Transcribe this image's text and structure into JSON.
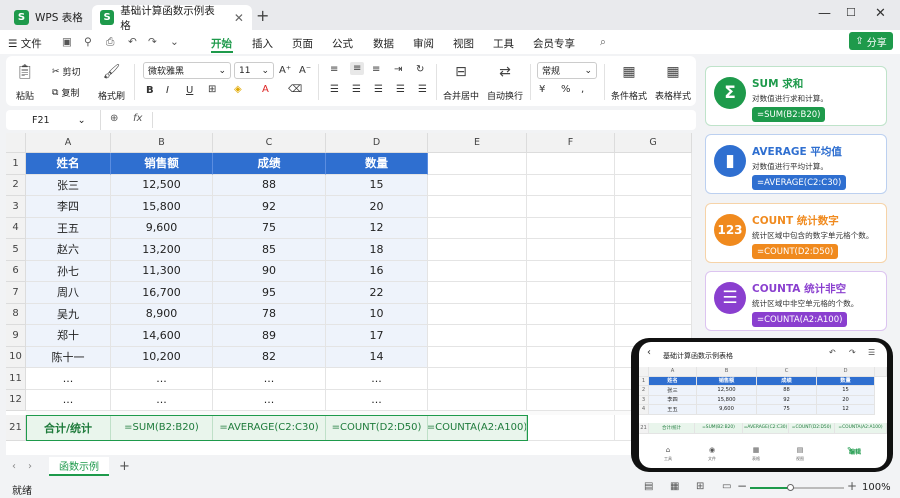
{
  "titlebar": {
    "tabs": [
      {
        "label": "WPS 表格"
      },
      {
        "label": "基础计算函数示例表格"
      }
    ],
    "new_tab": "+",
    "window_controls": [
      "—",
      "❐",
      "☐",
      "✕"
    ]
  },
  "menubar": {
    "file": "文件",
    "items": [
      {
        "label": "开始"
      },
      {
        "label": "插入"
      },
      {
        "label": "页面"
      },
      {
        "label": "公式"
      },
      {
        "label": "数据"
      },
      {
        "label": "审阅"
      },
      {
        "label": "视图"
      },
      {
        "label": "工具"
      },
      {
        "label": "会员专享"
      }
    ],
    "share": "分享"
  },
  "ribbon": {
    "paste": "粘贴",
    "cut": "剪切",
    "copy": "复制",
    "format_painter": "格式刷",
    "font_name": "微软雅黑",
    "font_size": "11",
    "merge": "合并居中",
    "wrap": "自动换行",
    "number_format": "常规",
    "conditional": "条件格式",
    "table_style": "表格样式"
  },
  "formula_bar": {
    "name_box": "F21",
    "fx": "fx",
    "value": ""
  },
  "columns": [
    "A",
    "B",
    "C",
    "D",
    "E",
    "F",
    "G"
  ],
  "rows": [
    "1",
    "2",
    "3",
    "4",
    "5",
    "6",
    "7",
    "8",
    "9",
    "10",
    "11",
    "12",
    "21"
  ],
  "table": {
    "headers": [
      "姓名",
      "销售额",
      "成绩",
      "数量"
    ],
    "data": [
      [
        "张三",
        "12,500",
        "88",
        "15"
      ],
      [
        "李四",
        "15,800",
        "92",
        "20"
      ],
      [
        "王五",
        "9,600",
        "75",
        "12"
      ],
      [
        "赵六",
        "13,200",
        "85",
        "18"
      ],
      [
        "孙七",
        "11,300",
        "90",
        "16"
      ],
      [
        "周八",
        "16,700",
        "95",
        "22"
      ],
      [
        "吴九",
        "8,900",
        "78",
        "10"
      ],
      [
        "郑十",
        "14,600",
        "89",
        "17"
      ],
      [
        "陈十一",
        "10,200",
        "82",
        "14"
      ],
      [
        "...",
        "...",
        "...",
        "..."
      ],
      [
        "...",
        "...",
        "...",
        "..."
      ]
    ],
    "totals": [
      "合计/统计",
      "=SUM(B2:B20)",
      "=AVERAGE(C2:C30)",
      "=COUNT(D2:D50)",
      "=COUNTA(A2:A100)"
    ]
  },
  "sheet_tabs": [
    {
      "label": "函数示例"
    }
  ],
  "status": {
    "left": "就绪",
    "zoom": "100%"
  },
  "cards": [
    {
      "icon": "Σ",
      "title": "SUM 求和",
      "desc": "对数值进行求和计算。",
      "formula": "=SUM(B2:B20)",
      "color": "#1e9a4b",
      "bg": "#ffffff",
      "border": "#bfe3ca"
    },
    {
      "icon": "▮",
      "title": "AVERAGE 平均值",
      "desc": "对数值进行平均计算。",
      "formula": "=AVERAGE(C2:C30)",
      "color": "#2f6fd0",
      "bg": "#ffffff",
      "border": "#bcd0f0"
    },
    {
      "icon": "123",
      "title": "COUNT 统计数字",
      "desc": "统计区域中包含的数字单元格个数。",
      "formula": "=COUNT(D2:D50)",
      "color": "#f08a1e",
      "bg": "#ffffff",
      "border": "#f6d3a8"
    },
    {
      "icon": "☰",
      "title": "COUNTA 统计非空",
      "desc": "统计区域中非空单元格的个数。",
      "formula": "=COUNTA(A2:A100)",
      "color": "#8a3fcf",
      "bg": "#ffffff",
      "border": "#dcc4f0"
    }
  ],
  "phone": {
    "title": "基础计算函数示例表格",
    "cols": [
      "A",
      "B",
      "C",
      "D"
    ],
    "headers": [
      "姓名",
      "销售额",
      "成绩",
      "数量"
    ],
    "rows": [
      [
        "张三",
        "12,500",
        "88",
        "15"
      ],
      [
        "李四",
        "15,800",
        "92",
        "20"
      ],
      [
        "王五",
        "9,600",
        "75",
        "12"
      ]
    ],
    "row_nums": [
      "1",
      "2",
      "3",
      "4",
      "21"
    ],
    "totals": [
      "合计/统计",
      "=SUM(B2:B20)",
      "=AVERAGE(C2:C30)",
      "=COUNT(D2:D50)",
      "=COUNTA(A2:A100)"
    ],
    "bottom": [
      {
        "label": "工具"
      },
      {
        "label": "文件"
      },
      {
        "label": "表格"
      },
      {
        "label": "视图"
      },
      {
        "label": "编辑"
      }
    ]
  }
}
